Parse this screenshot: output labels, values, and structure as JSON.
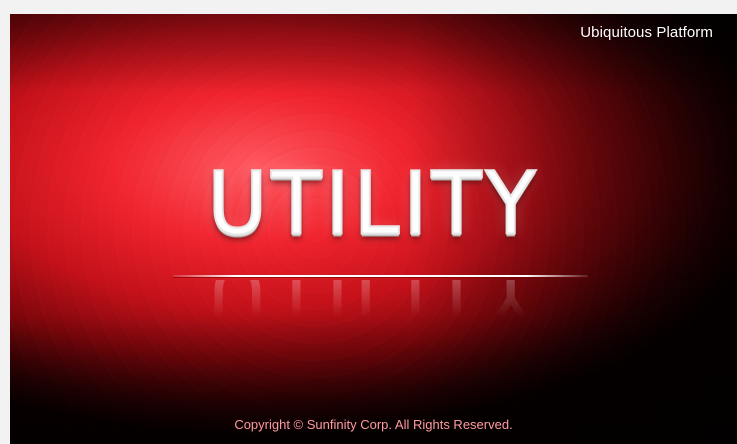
{
  "splash": {
    "tagline": "Ubiquitous Platform",
    "title": "UTILITY",
    "copyright": "Copyright © Sunfinity Corp. All Rights Reserved."
  },
  "colors": {
    "background_red": "#f0242e",
    "background_dark": "#0a0000",
    "title_text": "#ffffff",
    "copyright_text": "#ff9aa0"
  }
}
